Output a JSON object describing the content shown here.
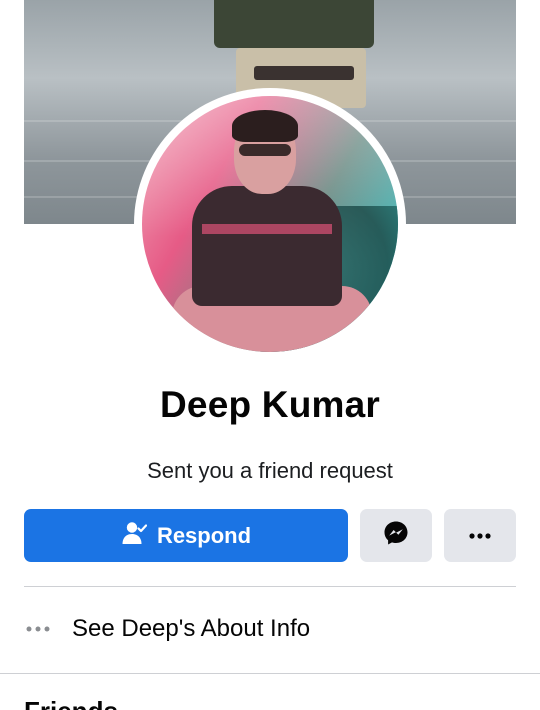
{
  "profile": {
    "name": "Deep Kumar",
    "status": "Sent you a friend request"
  },
  "actions": {
    "respond_label": "Respond",
    "respond_icon": "person-check-icon",
    "messenger_icon": "messenger-icon",
    "more_icon": "more-dots-icon"
  },
  "about": {
    "label": "See Deep's About Info",
    "icon": "more-dots-icon"
  },
  "sections": {
    "friends_heading": "Friends"
  },
  "colors": {
    "primary": "#1b74e4",
    "secondary_button": "#e4e6eb",
    "divider": "#ced0d4",
    "text": "#050505"
  }
}
